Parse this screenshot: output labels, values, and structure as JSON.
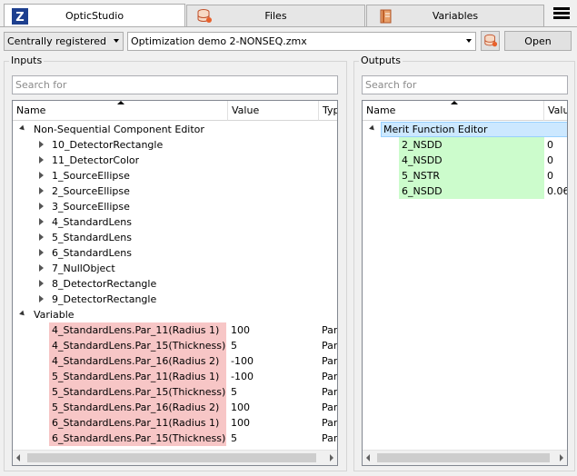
{
  "tabs": [
    {
      "label": "OpticStudio",
      "icon": "zemax-logo-icon",
      "active": true
    },
    {
      "label": "Files",
      "icon": "database-icon",
      "active": false
    },
    {
      "label": "Variables",
      "icon": "book-icon",
      "active": false
    }
  ],
  "toolbar": {
    "mode_select": "Centrally registered",
    "file_select": "Optimization demo 2-NONSEQ.zmx",
    "open_label": "Open"
  },
  "inputs": {
    "label": "Inputs",
    "search_placeholder": "Search for",
    "columns": [
      "Name",
      "Value",
      "Type"
    ],
    "groups": [
      {
        "label": "Non-Sequential Component Editor",
        "items": [
          "10_DetectorRectangle",
          "11_DetectorColor",
          "1_SourceEllipse",
          "2_SourceEllipse",
          "3_SourceEllipse",
          "4_StandardLens",
          "5_StandardLens",
          "6_StandardLens",
          "7_NullObject",
          "8_DetectorRectangle",
          "9_DetectorRectangle"
        ]
      },
      {
        "label": "Variable",
        "rows": [
          {
            "name": "4_StandardLens.Par_11(Radius 1)",
            "value": "100",
            "type": "Par"
          },
          {
            "name": "4_StandardLens.Par_15(Thickness)",
            "value": "5",
            "type": "Par"
          },
          {
            "name": "4_StandardLens.Par_16(Radius 2)",
            "value": "-100",
            "type": "Par"
          },
          {
            "name": "5_StandardLens.Par_11(Radius 1)",
            "value": "-100",
            "type": "Par"
          },
          {
            "name": "5_StandardLens.Par_15(Thickness)",
            "value": "5",
            "type": "Par"
          },
          {
            "name": "5_StandardLens.Par_16(Radius 2)",
            "value": "100",
            "type": "Par"
          },
          {
            "name": "6_StandardLens.Par_11(Radius 1)",
            "value": "100",
            "type": "Par"
          },
          {
            "name": "6_StandardLens.Par_15(Thickness)",
            "value": "5",
            "type": "Par"
          }
        ]
      }
    ]
  },
  "outputs": {
    "label": "Outputs",
    "search_placeholder": "Search for",
    "columns": [
      "Name",
      "Value"
    ],
    "group": "Merit Function Editor",
    "rows": [
      {
        "name": "2_NSDD",
        "value": "0"
      },
      {
        "name": "4_NSDD",
        "value": "0"
      },
      {
        "name": "5_NSTR",
        "value": "0"
      },
      {
        "name": "6_NSDD",
        "value": "0.06"
      }
    ]
  }
}
